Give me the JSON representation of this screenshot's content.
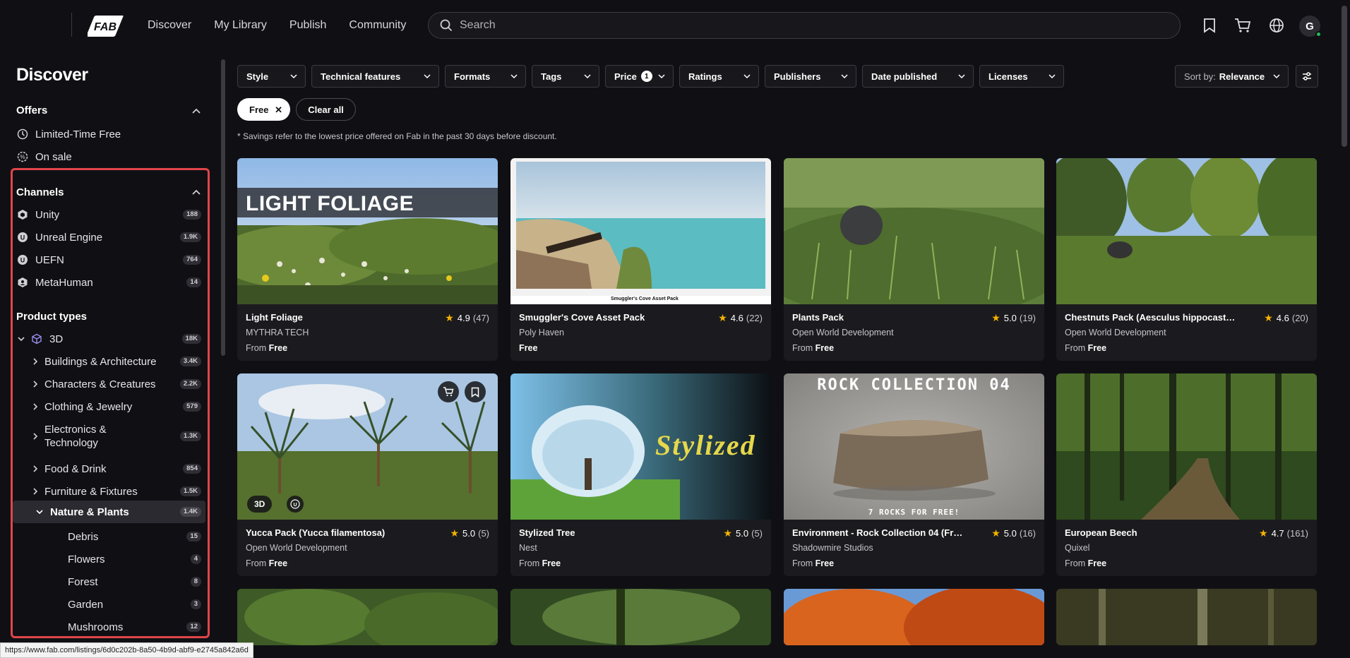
{
  "nav": {
    "items": [
      "Discover",
      "My Library",
      "Publish",
      "Community"
    ]
  },
  "search": {
    "placeholder": "Search"
  },
  "user": {
    "initial": "G"
  },
  "sidebar": {
    "title": "Discover",
    "offers": {
      "heading": "Offers",
      "items": [
        "Limited-Time Free",
        "On sale"
      ]
    },
    "channels": {
      "heading": "Channels",
      "items": [
        {
          "label": "Unity",
          "count": "188",
          "icon": "unity-icon"
        },
        {
          "label": "Unreal Engine",
          "count": "1.9K",
          "icon": "unreal-icon"
        },
        {
          "label": "UEFN",
          "count": "764",
          "icon": "uefn-icon"
        },
        {
          "label": "MetaHuman",
          "count": "14",
          "icon": "metahuman-icon"
        }
      ]
    },
    "product_types": {
      "heading": "Product types",
      "root": {
        "label": "3D",
        "count": "18K"
      },
      "items": [
        {
          "label": "Buildings & Architecture",
          "count": "3.4K"
        },
        {
          "label": "Characters & Creatures",
          "count": "2.2K"
        },
        {
          "label": "Clothing & Jewelry",
          "count": "579"
        },
        {
          "label": "Electronics & Technology",
          "count": "1.3K"
        },
        {
          "label": "Food & Drink",
          "count": "854"
        },
        {
          "label": "Furniture & Fixtures",
          "count": "1.5K"
        },
        {
          "label": "Nature & Plants",
          "count": "1.4K"
        }
      ],
      "sub_items": [
        {
          "label": "Debris",
          "count": "15"
        },
        {
          "label": "Flowers",
          "count": "4"
        },
        {
          "label": "Forest",
          "count": "8"
        },
        {
          "label": "Garden",
          "count": "3"
        },
        {
          "label": "Mushrooms",
          "count": "12"
        }
      ]
    }
  },
  "filters": {
    "buttons": [
      "Style",
      "Technical features",
      "Formats",
      "Tags",
      "Price",
      "Ratings",
      "Publishers",
      "Date published",
      "Licenses"
    ],
    "price_badge": "1",
    "sort_label": "Sort by:",
    "sort_value": "Relevance",
    "active_chip": "Free",
    "clear_all": "Clear all",
    "savings_note": "* Savings refer to the lowest price offered on Fab in the past 30 days before discount."
  },
  "cards": [
    {
      "title": "Light Foliage",
      "rating": "4.9",
      "reviews": "(47)",
      "seller": "MYTHRA TECH",
      "price_prefix": "From",
      "price": "Free",
      "image_text": "LIGHT FOLIAGE"
    },
    {
      "title": "Smuggler's Cove Asset Pack",
      "rating": "4.6",
      "reviews": "(22)",
      "seller": "Poly Haven",
      "price_prefix": "",
      "price": "Free",
      "image_text": "Smuggler's Cove Asset Pack"
    },
    {
      "title": "Plants Pack",
      "rating": "5.0",
      "reviews": "(19)",
      "seller": "Open World Development",
      "price_prefix": "From",
      "price": "Free"
    },
    {
      "title": "Chestnuts Pack (Aesculus hippocastan...",
      "rating": "4.6",
      "reviews": "(20)",
      "seller": "Open World Development",
      "price_prefix": "From",
      "price": "Free"
    },
    {
      "title": "Yucca Pack (Yucca filamentosa)",
      "rating": "5.0",
      "reviews": "(5)",
      "seller": "Open World Development",
      "price_prefix": "From",
      "price": "Free",
      "tag": "3D"
    },
    {
      "title": "Stylized Tree",
      "rating": "5.0",
      "reviews": "(5)",
      "seller": "Nest",
      "price_prefix": "From",
      "price": "Free",
      "image_text": "Stylized"
    },
    {
      "title": "Environment - Rock Collection 04 (Free)",
      "rating": "5.0",
      "reviews": "(16)",
      "seller": "Shadowmire Studios",
      "price_prefix": "From",
      "price": "Free",
      "image_text": "ROCK COLLECTION 04",
      "image_subtext": "7 ROCKS FOR FREE!"
    },
    {
      "title": "European Beech",
      "rating": "4.7",
      "reviews": "(161)",
      "seller": "Quixel",
      "price_prefix": "From",
      "price": "Free"
    }
  ],
  "status_url": "https://www.fab.com/listings/6d0c202b-8a50-4b9d-abf9-e2745a842a6d"
}
